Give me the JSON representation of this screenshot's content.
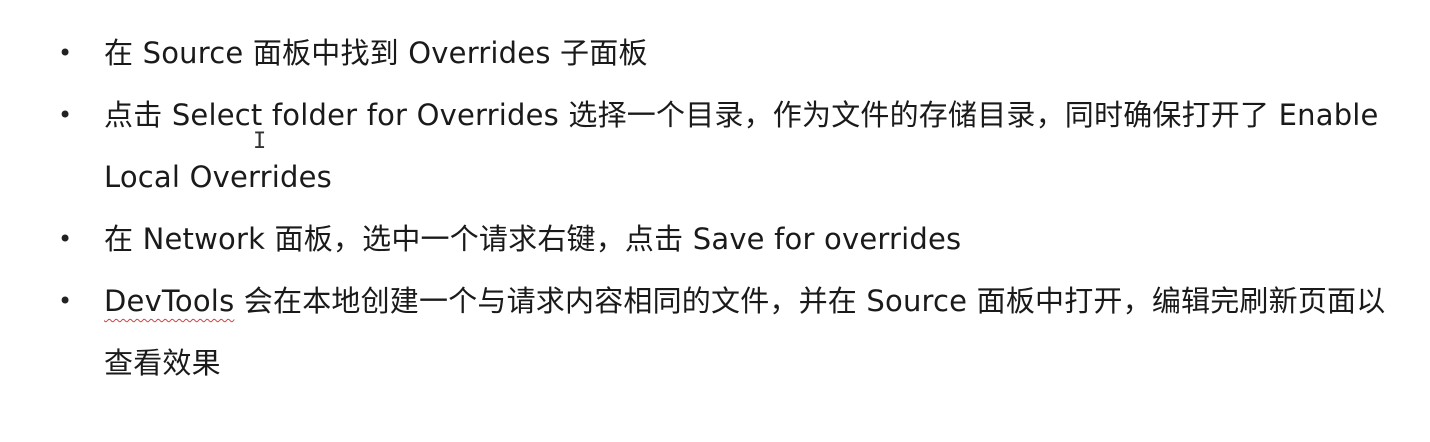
{
  "bullets": [
    {
      "marker": "•",
      "text": "在 Source 面板中找到 Overrides 子面板"
    },
    {
      "marker": "•",
      "text": "点击 Select folder for Overrides 选择一个目录，作为文件的存储目录，同时确保打开了 Enable Local Overrides"
    },
    {
      "marker": "•",
      "text": "在 Network 面板，选中一个请求右键，点击 Save for overrides"
    },
    {
      "marker": "•",
      "text_first_word": "DevTools",
      "text_rest": " 会在本地创建一个与请求内容相同的文件，并在 Source 面板中打开，编辑完刷新页面以查看效果"
    }
  ],
  "cursor": {
    "glyph": "I",
    "icon": "text-cursor-icon"
  },
  "colors": {
    "text": "#1a1a1a",
    "background": "#ffffff",
    "spellcheck_underline": "#d04040"
  }
}
